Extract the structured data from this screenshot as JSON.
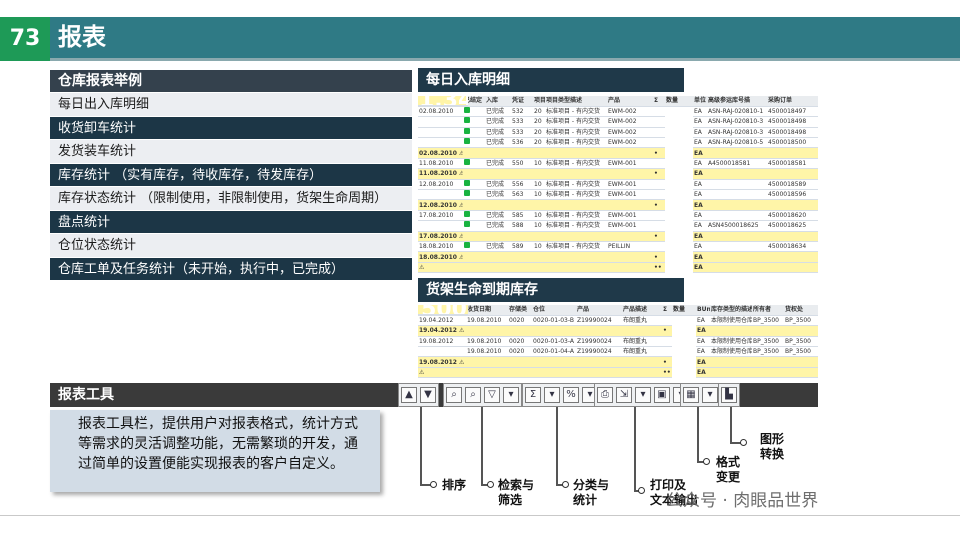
{
  "header": {
    "num": "73",
    "title": "报表"
  },
  "left_panel": {
    "title": "仓库报表举例",
    "items": [
      "每日出入库明细",
      "收货卸车统计",
      "发货装车统计",
      "库存统计 （实有库存，待收库存，待发库存）",
      "库存状态统计 （限制使用，非限制使用，货架生命周期）",
      "盘点统计",
      "仓位状态统计",
      "仓库工单及任务统计（未开始，执行中，已完成）"
    ]
  },
  "daily": {
    "title": "每日入库明细",
    "cols": [
      "入库(实际)",
      "已结定",
      "入库",
      "凭证",
      "项目",
      "项目类型描述",
      "产品",
      "Σ",
      "数量",
      "单位",
      "高级参运库号描",
      "采购订单"
    ],
    "rows": [
      {
        "k": "d",
        "c": [
          "02.08.2010",
          "●",
          "已完成",
          "532",
          "20",
          "标准项目 - 有内交货",
          "EWM-002",
          "",
          "10",
          "EA",
          "ASN-RAJ-020810-1",
          "4500018497"
        ]
      },
      {
        "k": "d",
        "c": [
          "",
          "●",
          "已完成",
          "533",
          "20",
          "标准项目 - 有内交货",
          "EWM-002",
          "",
          "10",
          "EA",
          "ASN-RAJ-020810-3",
          "4500018498"
        ]
      },
      {
        "k": "d",
        "c": [
          "",
          "●",
          "已完成",
          "533",
          "20",
          "标准项目 - 有内交货",
          "EWM-002",
          "",
          "10",
          "EA",
          "ASN-RAJ-020810-3",
          "4500018498"
        ]
      },
      {
        "k": "d",
        "c": [
          "",
          "●",
          "已完成",
          "536",
          "20",
          "标准项目 - 有内交货",
          "EWM-002",
          "",
          "10",
          "EA",
          "ASN-RAJ-020810-5",
          "4500018500"
        ]
      },
      {
        "k": "s",
        "c": [
          "02.08.2010 ⚠",
          "",
          "",
          "",
          "",
          "",
          "",
          "•",
          "50",
          "EA",
          "",
          ""
        ]
      },
      {
        "k": "d",
        "c": [
          "11.08.2010",
          "●",
          "已完成",
          "550",
          "10",
          "标准项目 - 有内交货",
          "EWM-001",
          "",
          "10",
          "EA",
          "A4500018581",
          "4500018581"
        ]
      },
      {
        "k": "s",
        "c": [
          "11.08.2010 ⚠",
          "",
          "",
          "",
          "",
          "",
          "",
          "•",
          "10",
          "EA",
          "",
          ""
        ]
      },
      {
        "k": "d",
        "c": [
          "12.08.2010",
          "●",
          "已完成",
          "556",
          "10",
          "标准项目 - 有内交货",
          "EWM-001",
          "",
          "100",
          "EA",
          "",
          "4500018589"
        ]
      },
      {
        "k": "d",
        "c": [
          "",
          "●",
          "已完成",
          "563",
          "10",
          "标准项目 - 有内交货",
          "EWM-001",
          "",
          "15",
          "EA",
          "",
          "4500018596"
        ]
      },
      {
        "k": "s",
        "c": [
          "12.08.2010 ⚠",
          "",
          "",
          "",
          "",
          "",
          "",
          "•",
          "115",
          "EA",
          "",
          ""
        ]
      },
      {
        "k": "d",
        "c": [
          "17.08.2010",
          "●",
          "已完成",
          "585",
          "10",
          "标准项目 - 有内交货",
          "EWM-001",
          "",
          "10",
          "EA",
          "",
          "4500018620"
        ]
      },
      {
        "k": "d",
        "c": [
          "",
          "●",
          "已完成",
          "588",
          "10",
          "标准项目 - 有内交货",
          "EWM-001",
          "",
          "1",
          "EA",
          "ASN4500018625",
          "4500018625"
        ]
      },
      {
        "k": "s",
        "c": [
          "17.08.2010 ⚠",
          "",
          "",
          "",
          "",
          "",
          "",
          "•",
          "11",
          "EA",
          "",
          ""
        ]
      },
      {
        "k": "d",
        "c": [
          "18.08.2010",
          "●",
          "已完成",
          "589",
          "10",
          "标准项目 - 有内交货",
          "PEILLIN",
          "",
          "10",
          "EA",
          "",
          "4500018634"
        ]
      },
      {
        "k": "s",
        "c": [
          "18.08.2010 ⚠",
          "",
          "",
          "",
          "",
          "",
          "",
          "•",
          "10",
          "EA",
          "",
          ""
        ]
      },
      {
        "k": "g",
        "c": [
          "⚠",
          "",
          "",
          "",
          "",
          "",
          "",
          "••",
          "1.340",
          "EA",
          "",
          ""
        ]
      }
    ]
  },
  "shelf": {
    "title": "货架生命到期库存",
    "cols": [
      "货架寿命到期",
      "收货日期",
      "存储类",
      "仓位",
      "产品",
      "产品描述",
      "Σ",
      "数量",
      "BUn",
      "库存类型的描述",
      "所有者",
      "货权处"
    ],
    "rows": [
      {
        "k": "d",
        "c": [
          "19.04.2012",
          "19.08.2010",
          "0020",
          "0020-01-03-B",
          "Z19990024",
          "布朗重丸",
          "",
          "230",
          "EA",
          "本限制使用仓库",
          "BP_3500",
          "BP_3500"
        ]
      },
      {
        "k": "s",
        "c": [
          "19.04.2012 ⚠",
          "",
          "",
          "",
          "",
          "",
          "•",
          "230",
          "EA",
          "",
          "",
          ""
        ]
      },
      {
        "k": "d",
        "c": [
          "19.08.2012",
          "19.08.2010",
          "0020",
          "0020-01-03-A",
          "Z19990024",
          "布朗重丸",
          "",
          "150",
          "EA",
          "本限制使用仓库",
          "BP_3500",
          "BP_3500"
        ]
      },
      {
        "k": "d",
        "c": [
          "",
          "19.08.2010",
          "0020",
          "0020-01-04-A",
          "Z19990024",
          "布朗重丸",
          "",
          "120",
          "EA",
          "本限制使用仓库",
          "BP_3500",
          "BP_3500"
        ]
      },
      {
        "k": "s",
        "c": [
          "19.08.2012 ⚠",
          "",
          "",
          "",
          "",
          "",
          "•",
          "270",
          "EA",
          "",
          "",
          ""
        ]
      },
      {
        "k": "g",
        "c": [
          "⚠",
          "",
          "",
          "",
          "",
          "",
          "••",
          "500",
          "EA",
          "",
          "",
          ""
        ]
      }
    ]
  },
  "tools": {
    "title": "报表工具",
    "desc": "报表工具栏，提供用户对报表格式，统计方式等需求的灵活调整功能，无需繁琐的开发，通过简单的设置便能实现报表的客户自定义。",
    "labels": {
      "sort": "排序",
      "search": "检索与\n筛选",
      "classify": "分类与\n统计",
      "print": "打印及\n文本输出",
      "format": "格式\n变更",
      "chart": "图形\n转换"
    }
  },
  "watermark": "公众号 · 肉眼品世界"
}
